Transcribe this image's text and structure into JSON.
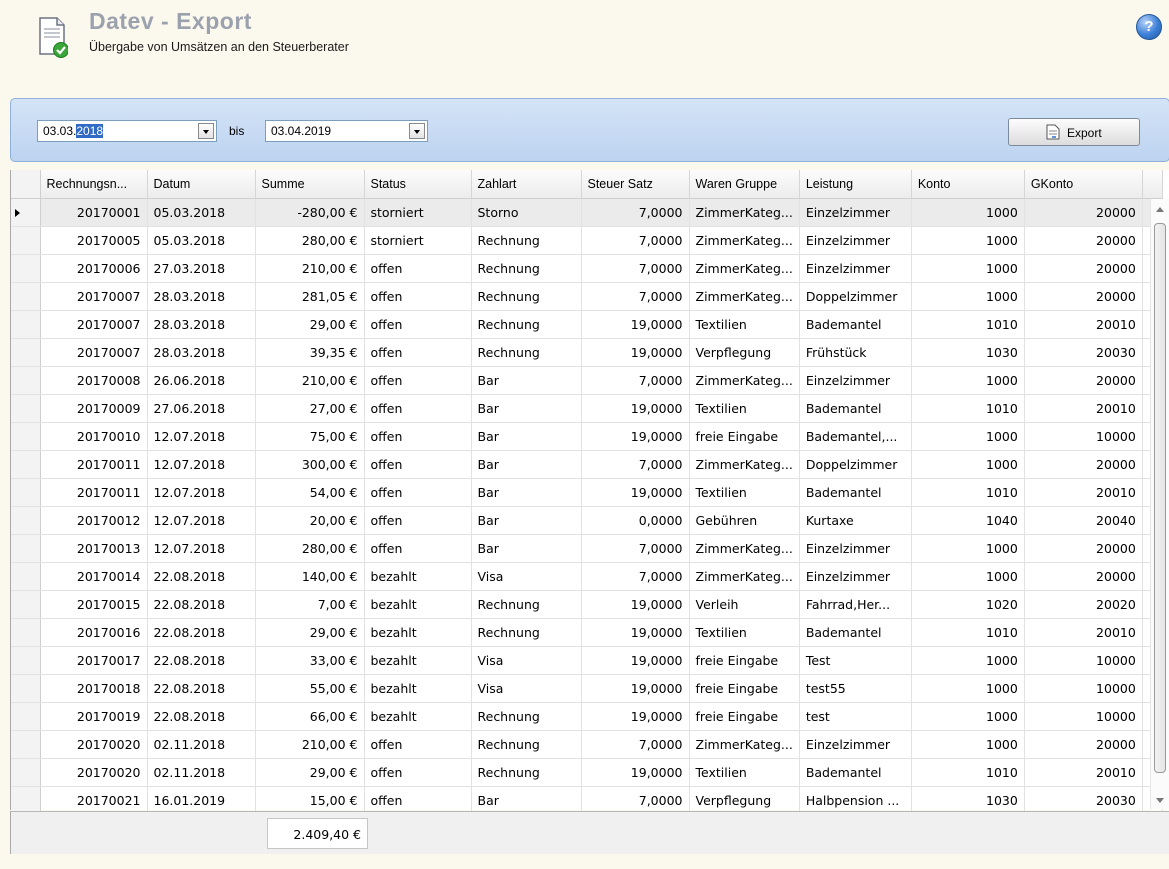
{
  "header": {
    "title": "Datev - Export",
    "subtitle": "Übergabe von Umsätzen an den Steuerberater",
    "help_symbol": "?"
  },
  "filter": {
    "from_date_prefix": "03.03.",
    "from_date_selected": "2018",
    "separator": "bis",
    "to_date": "03.04.2019",
    "export_label": "Export"
  },
  "columns": [
    "Rechnungsn...",
    "Datum",
    "Summe",
    "Status",
    "Zahlart",
    "Steuer Satz",
    "Waren Gruppe",
    "Leistung",
    "Konto",
    "GKonto"
  ],
  "rows": [
    [
      "20170001",
      "05.03.2018",
      "-280,00 €",
      "storniert",
      "Storno",
      "7,0000",
      "ZimmerKateg...",
      "Einzelzimmer",
      "1000",
      "20000"
    ],
    [
      "20170005",
      "05.03.2018",
      "280,00 €",
      "storniert",
      "Rechnung",
      "7,0000",
      "ZimmerKateg...",
      "Einzelzimmer",
      "1000",
      "20000"
    ],
    [
      "20170006",
      "27.03.2018",
      "210,00 €",
      "offen",
      "Rechnung",
      "7,0000",
      "ZimmerKateg...",
      "Einzelzimmer",
      "1000",
      "20000"
    ],
    [
      "20170007",
      "28.03.2018",
      "281,05 €",
      "offen",
      "Rechnung",
      "7,0000",
      "ZimmerKateg...",
      "Doppelzimmer",
      "1000",
      "20000"
    ],
    [
      "20170007",
      "28.03.2018",
      "29,00 €",
      "offen",
      "Rechnung",
      "19,0000",
      "Textilien",
      "Bademantel",
      "1010",
      "20010"
    ],
    [
      "20170007",
      "28.03.2018",
      "39,35 €",
      "offen",
      "Rechnung",
      "19,0000",
      "Verpflegung",
      "Frühstück",
      "1030",
      "20030"
    ],
    [
      "20170008",
      "26.06.2018",
      "210,00 €",
      "offen",
      "Bar",
      "7,0000",
      "ZimmerKateg...",
      "Einzelzimmer",
      "1000",
      "20000"
    ],
    [
      "20170009",
      "27.06.2018",
      "27,00 €",
      "offen",
      "Bar",
      "19,0000",
      "Textilien",
      "Bademantel",
      "1010",
      "20010"
    ],
    [
      "20170010",
      "12.07.2018",
      "75,00 €",
      "offen",
      "Bar",
      "19,0000",
      "freie Eingabe",
      "Bademantel,...",
      "1000",
      "10000"
    ],
    [
      "20170011",
      "12.07.2018",
      "300,00 €",
      "offen",
      "Bar",
      "7,0000",
      "ZimmerKateg...",
      "Doppelzimmer",
      "1000",
      "20000"
    ],
    [
      "20170011",
      "12.07.2018",
      "54,00 €",
      "offen",
      "Bar",
      "19,0000",
      "Textilien",
      "Bademantel",
      "1010",
      "20010"
    ],
    [
      "20170012",
      "12.07.2018",
      "20,00 €",
      "offen",
      "Bar",
      "0,0000",
      "Gebühren",
      "Kurtaxe",
      "1040",
      "20040"
    ],
    [
      "20170013",
      "12.07.2018",
      "280,00 €",
      "offen",
      "Bar",
      "7,0000",
      "ZimmerKateg...",
      "Einzelzimmer",
      "1000",
      "20000"
    ],
    [
      "20170014",
      "22.08.2018",
      "140,00 €",
      "bezahlt",
      "Visa",
      "7,0000",
      "ZimmerKateg...",
      "Einzelzimmer",
      "1000",
      "20000"
    ],
    [
      "20170015",
      "22.08.2018",
      "7,00 €",
      "bezahlt",
      "Rechnung",
      "19,0000",
      "Verleih",
      "Fahrrad,Her...",
      "1020",
      "20020"
    ],
    [
      "20170016",
      "22.08.2018",
      "29,00 €",
      "bezahlt",
      "Rechnung",
      "19,0000",
      "Textilien",
      "Bademantel",
      "1010",
      "20010"
    ],
    [
      "20170017",
      "22.08.2018",
      "33,00 €",
      "bezahlt",
      "Visa",
      "19,0000",
      "freie Eingabe",
      "Test",
      "1000",
      "10000"
    ],
    [
      "20170018",
      "22.08.2018",
      "55,00 €",
      "bezahlt",
      "Visa",
      "19,0000",
      "freie Eingabe",
      "test55",
      "1000",
      "10000"
    ],
    [
      "20170019",
      "22.08.2018",
      "66,00 €",
      "bezahlt",
      "Rechnung",
      "19,0000",
      "freie Eingabe",
      "test",
      "1000",
      "10000"
    ],
    [
      "20170020",
      "02.11.2018",
      "210,00 €",
      "offen",
      "Rechnung",
      "7,0000",
      "ZimmerKateg...",
      "Einzelzimmer",
      "1000",
      "20000"
    ],
    [
      "20170020",
      "02.11.2018",
      "29,00 €",
      "offen",
      "Rechnung",
      "19,0000",
      "Textilien",
      "Bademantel",
      "1010",
      "20010"
    ],
    [
      "20170021",
      "16.01.2019",
      "15,00 €",
      "offen",
      "Bar",
      "7,0000",
      "Verpflegung",
      "Halbpension ...",
      "1030",
      "20030"
    ]
  ],
  "footer": {
    "sum_total": "2.409,40 €"
  }
}
